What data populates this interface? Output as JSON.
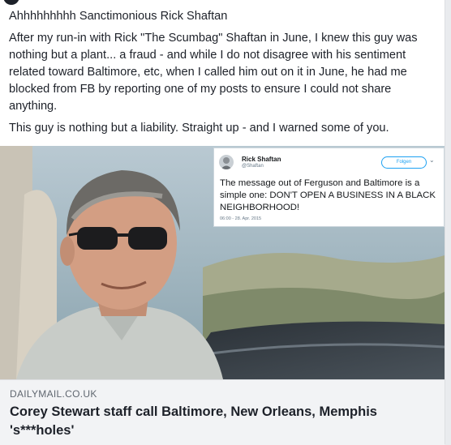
{
  "post": {
    "title_line": "Ahhhhhhhhh Sanctimonious Rick Shaftan",
    "paragraph_1": "After my run-in with Rick \"The Scumbag\" Shaftan in June, I knew this guy was nothing but a plant... a fraud - and while I do not disagree with his sentiment related toward Baltimore, etc, when I called him out on it in June, he had me blocked from FB by reporting one of my posts to ensure I could not share anything.",
    "paragraph_2": "This guy is nothing but a liability. Straight up - and I warned some of you."
  },
  "tweet": {
    "name": "Rick Shaftan",
    "handle": "@Shaftan",
    "follow_label": "Folgen",
    "caret_icon": "chevron-down-icon",
    "body": "The message out of Ferguson and Baltimore is a simple one: DON'T OPEN A BUSINESS IN A BLACK NEIGHBORHOOD!",
    "date": "06:00 - 28. Apr. 2015"
  },
  "link_preview": {
    "domain": "DAILYMAIL.CO.UK",
    "headline": "Corey Stewart staff call Baltimore, New Orleans, Memphis 's***holes'"
  },
  "colors": {
    "text": "#1d2129",
    "meta_bg": "#f2f3f5",
    "twitter_blue": "#1da1f2"
  }
}
